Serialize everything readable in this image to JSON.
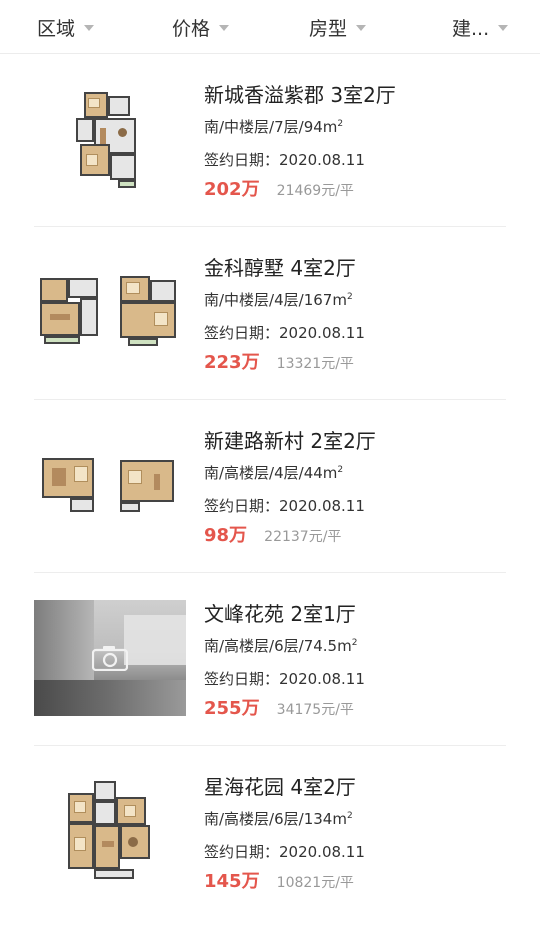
{
  "filters": [
    {
      "label": "区域"
    },
    {
      "label": "价格"
    },
    {
      "label": "房型"
    },
    {
      "label": "建..."
    }
  ],
  "listings": [
    {
      "title": "新城香溢紫郡 3室2厅",
      "meta": "南/中楼层/7层/94m",
      "date": "签约日期：2020.08.11",
      "price": "202万",
      "unit_price": "21469元/平",
      "image": "floor-plan-single"
    },
    {
      "title": "金科醇墅 4室2厅",
      "meta": "南/中楼层/4层/167m",
      "date": "签约日期：2020.08.11",
      "price": "223万",
      "unit_price": "13321元/平",
      "image": "floor-plan-double"
    },
    {
      "title": "新建路新村 2室2厅",
      "meta": "南/高楼层/4层/44m",
      "date": "签约日期：2020.08.11",
      "price": "98万",
      "unit_price": "22137元/平",
      "image": "floor-plan-double"
    },
    {
      "title": "文峰花苑 2室1厅",
      "meta": "南/高楼层/6层/74.5m",
      "date": "签约日期：2020.08.11",
      "price": "255万",
      "unit_price": "34175元/平",
      "image": "photo-placeholder-camera"
    },
    {
      "title": "星海花园 4室2厅",
      "meta": "南/高楼层/6层/134m",
      "date": "签约日期：2020.08.11",
      "price": "145万",
      "unit_price": "10821元/平",
      "image": "floor-plan-single"
    }
  ],
  "area_unit_sup": "2",
  "colors": {
    "price": "#e4564c",
    "text": "#333333",
    "muted": "#999999",
    "divider": "#ededed"
  }
}
